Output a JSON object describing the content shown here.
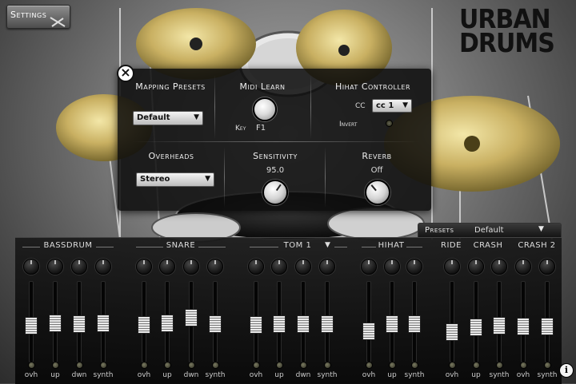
{
  "settings_button": {
    "label": "Settings"
  },
  "logo": {
    "line1": "URBAN",
    "line2": "DRUMS"
  },
  "settings_panel": {
    "close_icon": "close-icon",
    "mapping_presets": {
      "title": "Mapping Presets",
      "selected": "Default"
    },
    "midi_learn": {
      "title": "Midi Learn",
      "key_label": "Key",
      "key_value": "F1"
    },
    "hihat_controller": {
      "title": "Hihat Controller",
      "cc_label": "CC",
      "cc_value": "cc 1",
      "invert_label": "Invert"
    },
    "overheads": {
      "title": "Overheads",
      "selected": "Stereo"
    },
    "sensitivity": {
      "title": "Sensitivity",
      "value": "95.0"
    },
    "reverb": {
      "title": "Reverb",
      "value": "Off"
    }
  },
  "mixer": {
    "presets_label": "Presets",
    "presets_value": "Default",
    "groups": {
      "bassdrum": "BASSDRUM",
      "snare": "SNARE",
      "tom": "TOM 1",
      "hihat": "HIHAT",
      "ride": "RIDE",
      "crash": "CRASH",
      "crash2": "CRASH 2"
    },
    "channels": [
      {
        "label": "ovh",
        "level": 0.45
      },
      {
        "label": "up",
        "level": 0.48
      },
      {
        "label": "dwn",
        "level": 0.47
      },
      {
        "label": "synth",
        "level": 0.48
      },
      {
        "label": "ovh",
        "level": 0.46
      },
      {
        "label": "up",
        "level": 0.48
      },
      {
        "label": "dwn",
        "level": 0.55
      },
      {
        "label": "synth",
        "level": 0.47
      },
      {
        "label": "ovh",
        "level": 0.46
      },
      {
        "label": "up",
        "level": 0.47
      },
      {
        "label": "dwn",
        "level": 0.47
      },
      {
        "label": "synth",
        "level": 0.47
      },
      {
        "label": "ovh",
        "level": 0.38
      },
      {
        "label": "up",
        "level": 0.47
      },
      {
        "label": "synth",
        "level": 0.47
      },
      {
        "label": "ovh",
        "level": 0.37
      },
      {
        "label": "up",
        "level": 0.43
      },
      {
        "label": "synth",
        "level": 0.45
      },
      {
        "label": "ovh",
        "level": 0.44
      },
      {
        "label": "synth",
        "level": 0.44
      }
    ],
    "info_icon": "info-icon"
  }
}
